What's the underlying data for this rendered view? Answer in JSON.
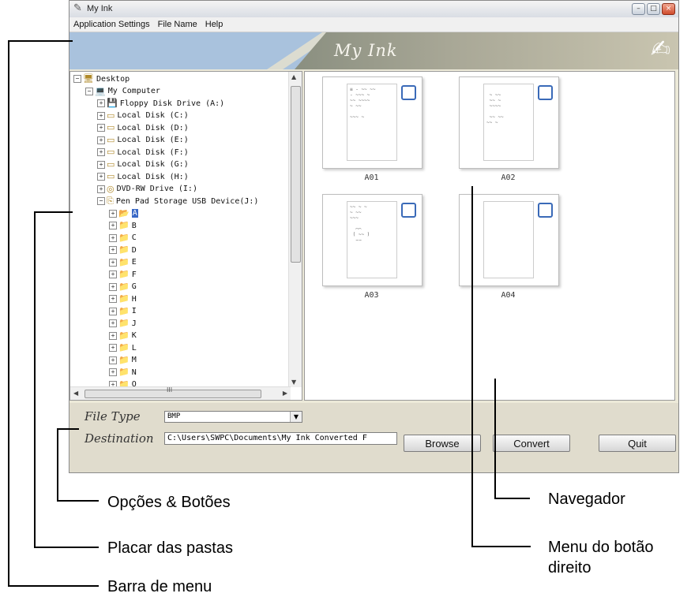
{
  "window": {
    "title": "My Ink",
    "app_icon": "pen-ink-icon",
    "controls": {
      "minimize": "–",
      "maximize": "□",
      "close": "×"
    }
  },
  "menubar": {
    "items": [
      "Application Settings",
      "File Name",
      "Help"
    ]
  },
  "banner": {
    "brand": "My Ink",
    "art_icon": "paper-pen-icon"
  },
  "tree": {
    "items": [
      {
        "label": "Desktop",
        "indent": 0,
        "icon": "desktop-icon",
        "expander": "−",
        "selected": false
      },
      {
        "label": "My Computer",
        "indent": 1,
        "icon": "computer-icon",
        "expander": "−",
        "selected": false
      },
      {
        "label": "Floppy Disk Drive (A:)",
        "indent": 2,
        "icon": "floppy-icon",
        "expander": "+",
        "selected": false
      },
      {
        "label": "Local Disk (C:)",
        "indent": 2,
        "icon": "disk-icon",
        "expander": "+",
        "selected": false
      },
      {
        "label": "Local Disk (D:)",
        "indent": 2,
        "icon": "disk-icon",
        "expander": "+",
        "selected": false
      },
      {
        "label": "Local Disk (E:)",
        "indent": 2,
        "icon": "disk-icon",
        "expander": "+",
        "selected": false
      },
      {
        "label": "Local Disk (F:)",
        "indent": 2,
        "icon": "disk-icon",
        "expander": "+",
        "selected": false
      },
      {
        "label": "Local Disk (G:)",
        "indent": 2,
        "icon": "disk-icon",
        "expander": "+",
        "selected": false
      },
      {
        "label": "Local Disk (H:)",
        "indent": 2,
        "icon": "disk-icon",
        "expander": "+",
        "selected": false
      },
      {
        "label": "DVD-RW Drive (I:)",
        "indent": 2,
        "icon": "dvd-icon",
        "expander": "+",
        "selected": false
      },
      {
        "label": "Pen Pad Storage USB Device(J:)",
        "indent": 2,
        "icon": "usb-drive-icon",
        "expander": "−",
        "selected": false
      },
      {
        "label": "A",
        "indent": 3,
        "icon": "folder-open-icon",
        "expander": "+",
        "selected": true
      },
      {
        "label": "B",
        "indent": 3,
        "icon": "folder-icon",
        "expander": "+",
        "selected": false
      },
      {
        "label": "C",
        "indent": 3,
        "icon": "folder-icon",
        "expander": "+",
        "selected": false
      },
      {
        "label": "D",
        "indent": 3,
        "icon": "folder-icon",
        "expander": "+",
        "selected": false
      },
      {
        "label": "E",
        "indent": 3,
        "icon": "folder-icon",
        "expander": "+",
        "selected": false
      },
      {
        "label": "F",
        "indent": 3,
        "icon": "folder-icon",
        "expander": "+",
        "selected": false
      },
      {
        "label": "G",
        "indent": 3,
        "icon": "folder-icon",
        "expander": "+",
        "selected": false
      },
      {
        "label": "H",
        "indent": 3,
        "icon": "folder-icon",
        "expander": "+",
        "selected": false
      },
      {
        "label": "I",
        "indent": 3,
        "icon": "folder-icon",
        "expander": "+",
        "selected": false
      },
      {
        "label": "J",
        "indent": 3,
        "icon": "folder-icon",
        "expander": "+",
        "selected": false
      },
      {
        "label": "K",
        "indent": 3,
        "icon": "folder-icon",
        "expander": "+",
        "selected": false
      },
      {
        "label": "L",
        "indent": 3,
        "icon": "folder-icon",
        "expander": "+",
        "selected": false
      },
      {
        "label": "M",
        "indent": 3,
        "icon": "folder-icon",
        "expander": "+",
        "selected": false
      },
      {
        "label": "N",
        "indent": 3,
        "icon": "folder-icon",
        "expander": "+",
        "selected": false
      },
      {
        "label": "O",
        "indent": 3,
        "icon": "folder-icon",
        "expander": "+",
        "selected": false
      }
    ],
    "hscroll_grip": "III"
  },
  "thumbnails": [
    {
      "label": "A01",
      "sketch": "≡ - ~~ ~~\n- ~~~ ~\n~~ ~~~~\n~ ~~\n\n~~~ ~"
    },
    {
      "label": "A02",
      "sketch": "\n ~ ~~\n ~~ ~\n ~~~~\n\n ~~ ~~\n~~ ~"
    },
    {
      "label": "A03",
      "sketch": "~~ ~ ~\n~ ~~\n~~~\n\n  ⌒⌒\n ( ~~ )\n  ⌣⌣"
    },
    {
      "label": "A04",
      "sketch": ""
    }
  ],
  "footer": {
    "file_type_label": "File Type",
    "file_type_value": "BMP",
    "destination_label": "Destination",
    "destination_value": "C:\\Users\\SWPC\\Documents\\My Ink Converted F",
    "browse": "Browse",
    "convert": "Convert",
    "quit": "Quit"
  },
  "callouts": {
    "options": "Opções & Botões",
    "folders": "Placar das pastas",
    "menubar": "Barra de menu",
    "browser": "Navegador",
    "context_menu_line1": "Menu do botão",
    "context_menu_line2": "direito"
  },
  "colors": {
    "banner_blue": "#a9c2dd",
    "selection": "#3968c6",
    "checkbox": "#3a6ab8",
    "footer_bg": "#e0dccd"
  }
}
